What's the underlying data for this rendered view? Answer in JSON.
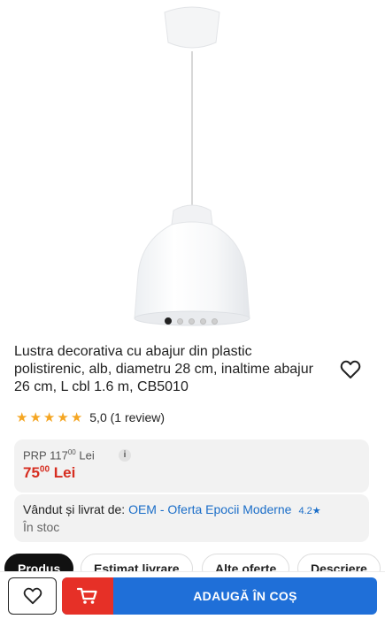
{
  "product": {
    "title": "Lustra decorativa cu abajur din plastic polistirenic, alb, diametru 28 cm, inaltime abajur 26 cm, L cbl 1.6 m, CB5010",
    "gallery_dots": 5,
    "gallery_active_index": 0
  },
  "rating": {
    "stars": 5,
    "text": "5,0 (1 review)"
  },
  "pricing": {
    "prp_prefix": "PRP 117",
    "prp_cents": "00",
    "prp_currency": " Lei",
    "price_main": "75",
    "price_cents": "00",
    "price_currency": " Lei",
    "info_icon": "i"
  },
  "seller": {
    "label": "Vândut și livrat de: ",
    "name": "OEM - Oferta Epocii Moderne",
    "rating": "4.2★",
    "stock": "În stoc"
  },
  "tabs": [
    {
      "label": "Produs",
      "active": true
    },
    {
      "label": "Estimat livrare",
      "active": false
    },
    {
      "label": "Alte oferte",
      "active": false
    },
    {
      "label": "Descriere",
      "active": false
    }
  ],
  "bottom_bar": {
    "add_to_cart_label": "ADAUGĂ ÎN COȘ",
    "favorite_icon": "heart-icon",
    "cart_icon": "cart-icon"
  },
  "colors": {
    "price_red": "#d62d20",
    "link_blue": "#1a6dc8",
    "cart_blue": "#1f6fd8",
    "cart_red": "#e63027",
    "star_yellow": "#f5a623"
  }
}
